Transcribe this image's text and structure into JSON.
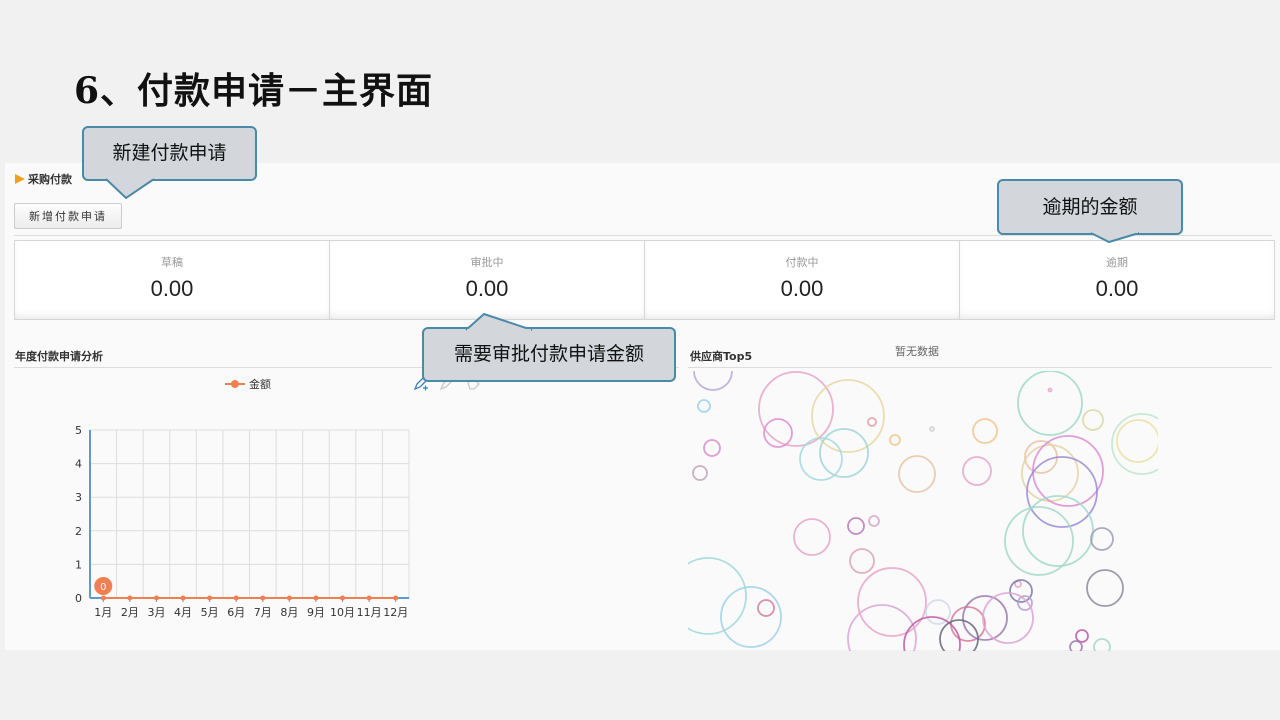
{
  "slide": {
    "title": "6、付款申请－主界面"
  },
  "module": {
    "title": "采购付款",
    "new_button": "新增付款申请"
  },
  "stats": [
    {
      "label": "草稿",
      "value": "0.00"
    },
    {
      "label": "审批中",
      "value": "0.00"
    },
    {
      "label": "付款中",
      "value": "0.00"
    },
    {
      "label": "逾期",
      "value": "0.00"
    }
  ],
  "annual": {
    "title": "年度付款申请分析",
    "legend": "金额",
    "tools": [
      "pen-icon",
      "eraser-icon",
      "clear-icon"
    ]
  },
  "supplier": {
    "title": "供应商Top5",
    "empty_text": "暂无数据"
  },
  "callouts": {
    "new": "新建付款申请",
    "overdue": "逾期的金额",
    "approval": "需要审批付款申请金额"
  },
  "chart_data": {
    "type": "line",
    "categories": [
      "1月",
      "2月",
      "3月",
      "4月",
      "5月",
      "6月",
      "7月",
      "8月",
      "9月",
      "10月",
      "11月",
      "12月"
    ],
    "series": [
      {
        "name": "金额",
        "values": [
          0,
          0,
          0,
          0,
          0,
          0,
          0,
          0,
          0,
          0,
          0,
          0
        ]
      }
    ],
    "ylim": [
      0,
      5
    ],
    "yticks": [
      0,
      1,
      2,
      3,
      4,
      5
    ],
    "point_label": "0",
    "grid": true,
    "legend": "top-center",
    "colors": {
      "line": "#f07f52",
      "axis": "#5b9bd5"
    }
  }
}
